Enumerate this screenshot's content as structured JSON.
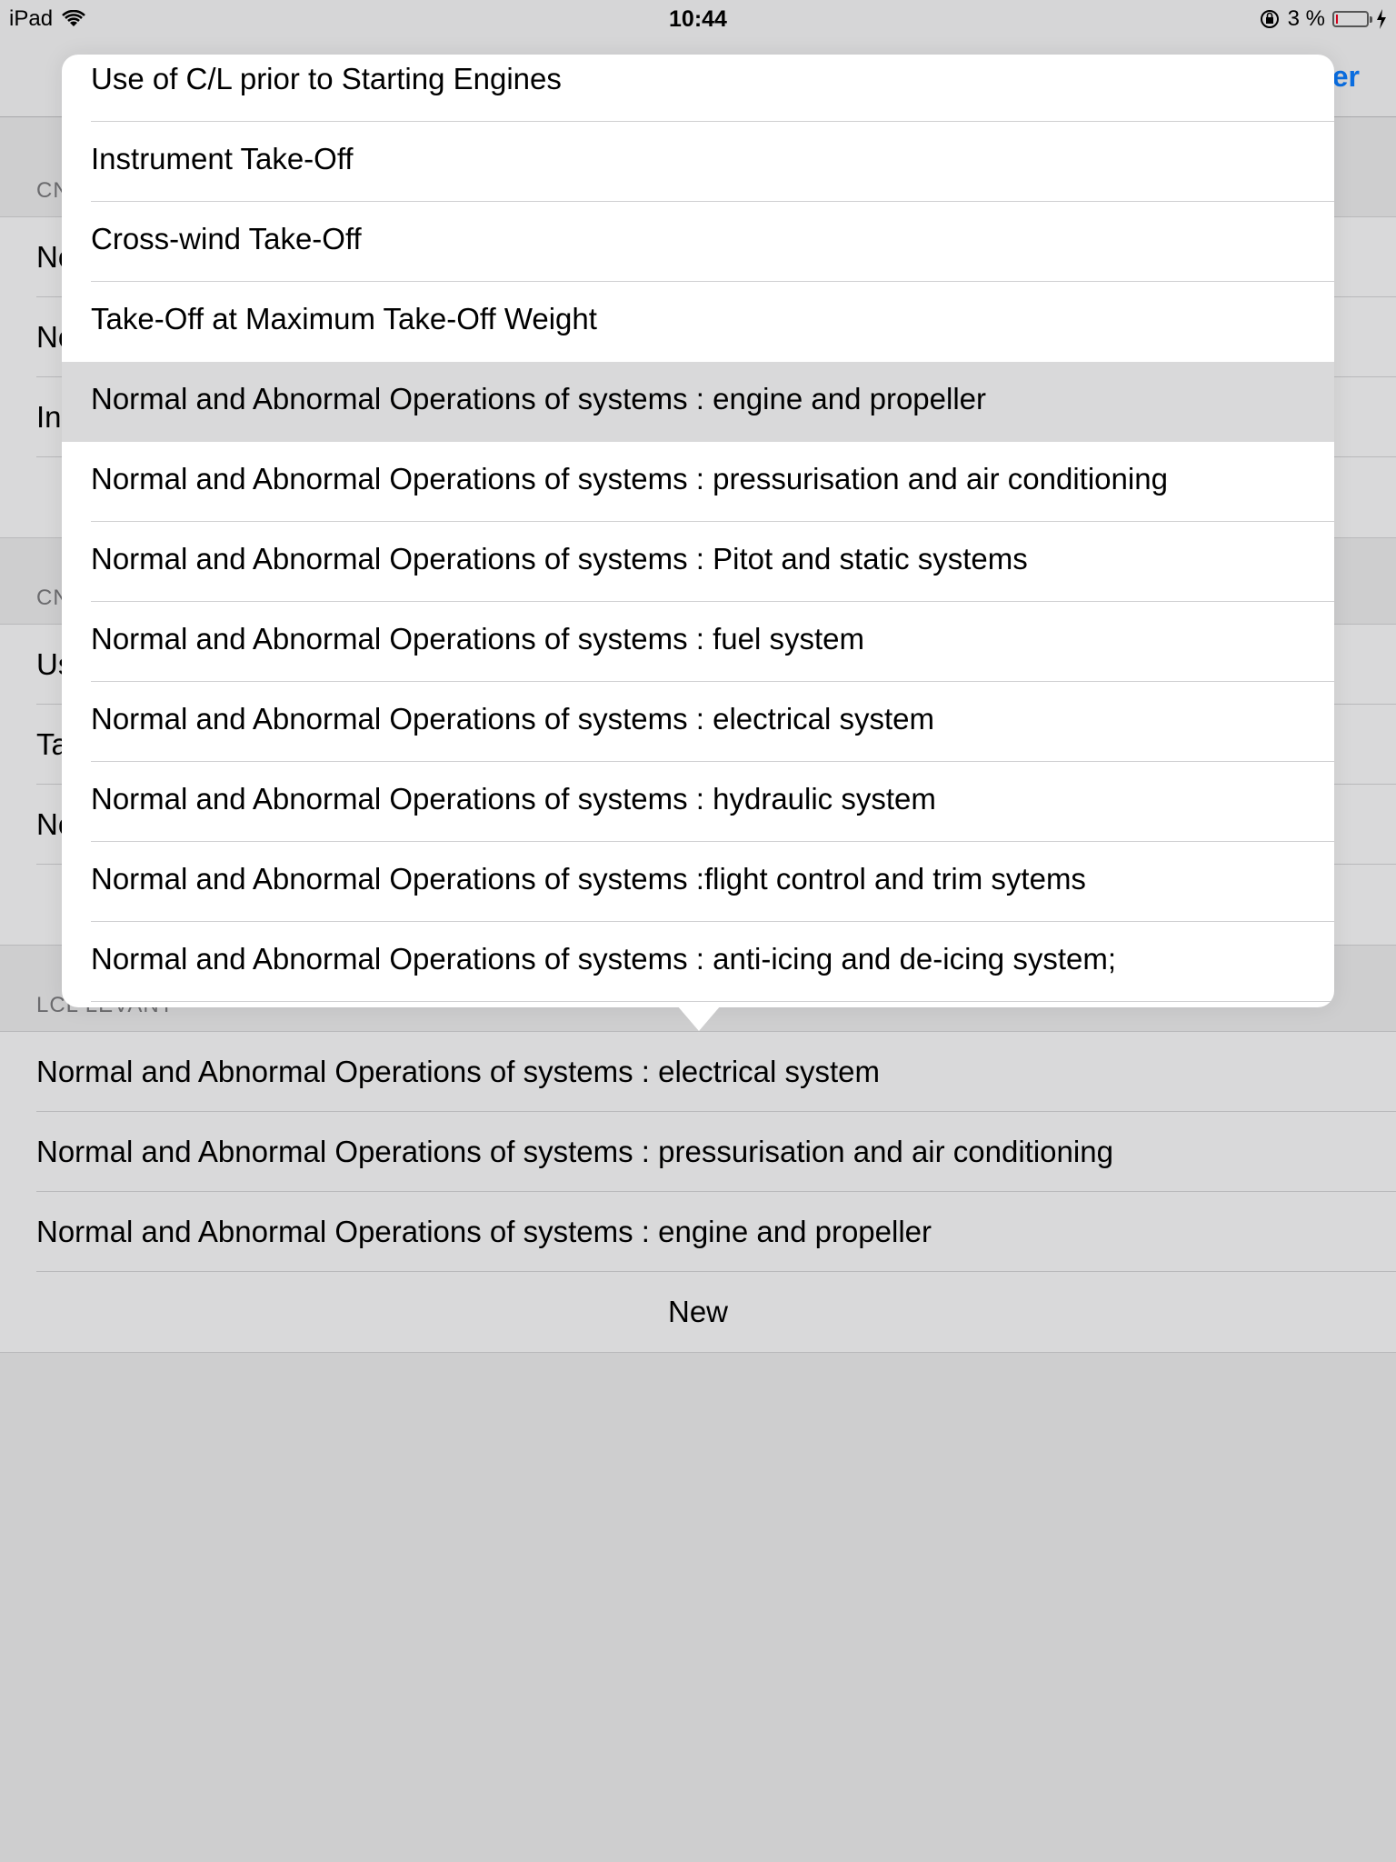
{
  "status_bar": {
    "device": "iPad",
    "time": "10:44",
    "battery_text": "3 %",
    "battery_level": 0.03
  },
  "nav": {
    "right_button": "er"
  },
  "background": {
    "section_1_header": "CN",
    "section_1_rows": [
      "No",
      "No",
      "In"
    ],
    "section_2_header": "CN",
    "section_2_rows": [
      "Us",
      "Ta",
      "No"
    ],
    "section_3_header": "LCL LEVANT",
    "section_3_rows": [
      "Normal and Abnormal Operations of systems : electrical system",
      "Normal and Abnormal Operations of systems : pressurisation and air conditioning",
      "Normal and Abnormal Operations of systems : engine and propeller"
    ],
    "new_label": "New"
  },
  "popover": {
    "items": [
      "Use of C/L prior to Starting Engines",
      "Instrument Take-Off",
      "Cross-wind Take-Off",
      "Take-Off at Maximum Take-Off Weight",
      "Normal and Abnormal Operations of systems : engine and propeller",
      "Normal and Abnormal Operations of systems : pressurisation and air conditioning",
      "Normal and Abnormal Operations of systems : Pitot and static systems",
      "Normal and Abnormal Operations of systems : fuel system",
      "Normal and Abnormal Operations of systems : electrical system",
      "Normal and Abnormal Operations of systems : hydraulic system",
      "Normal and Abnormal Operations of systems :flight control and trim sytems",
      "Normal and Abnormal Operations of systems : anti-icing and de-icing system;"
    ],
    "selected_index": 4
  }
}
